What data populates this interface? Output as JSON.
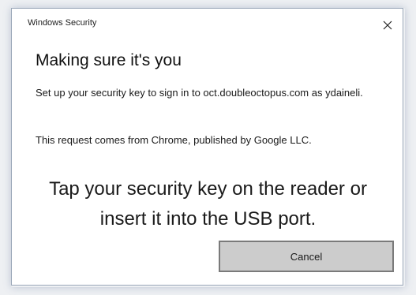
{
  "window": {
    "title": "Windows Security",
    "close_icon": "close-icon"
  },
  "content": {
    "heading": "Making sure it's you",
    "setup_text": "Set up your security key to sign in to oct.doubleoctopus.com as ydaineli.",
    "request_text": "This request comes from Chrome, published by Google LLC.",
    "instruction": "Tap your security key on the reader or insert it into the USB port."
  },
  "actions": {
    "cancel_label": "Cancel"
  },
  "colors": {
    "button_background": "#cccccc",
    "button_border": "#7a7a7a",
    "dialog_border": "#9aa7b8"
  }
}
